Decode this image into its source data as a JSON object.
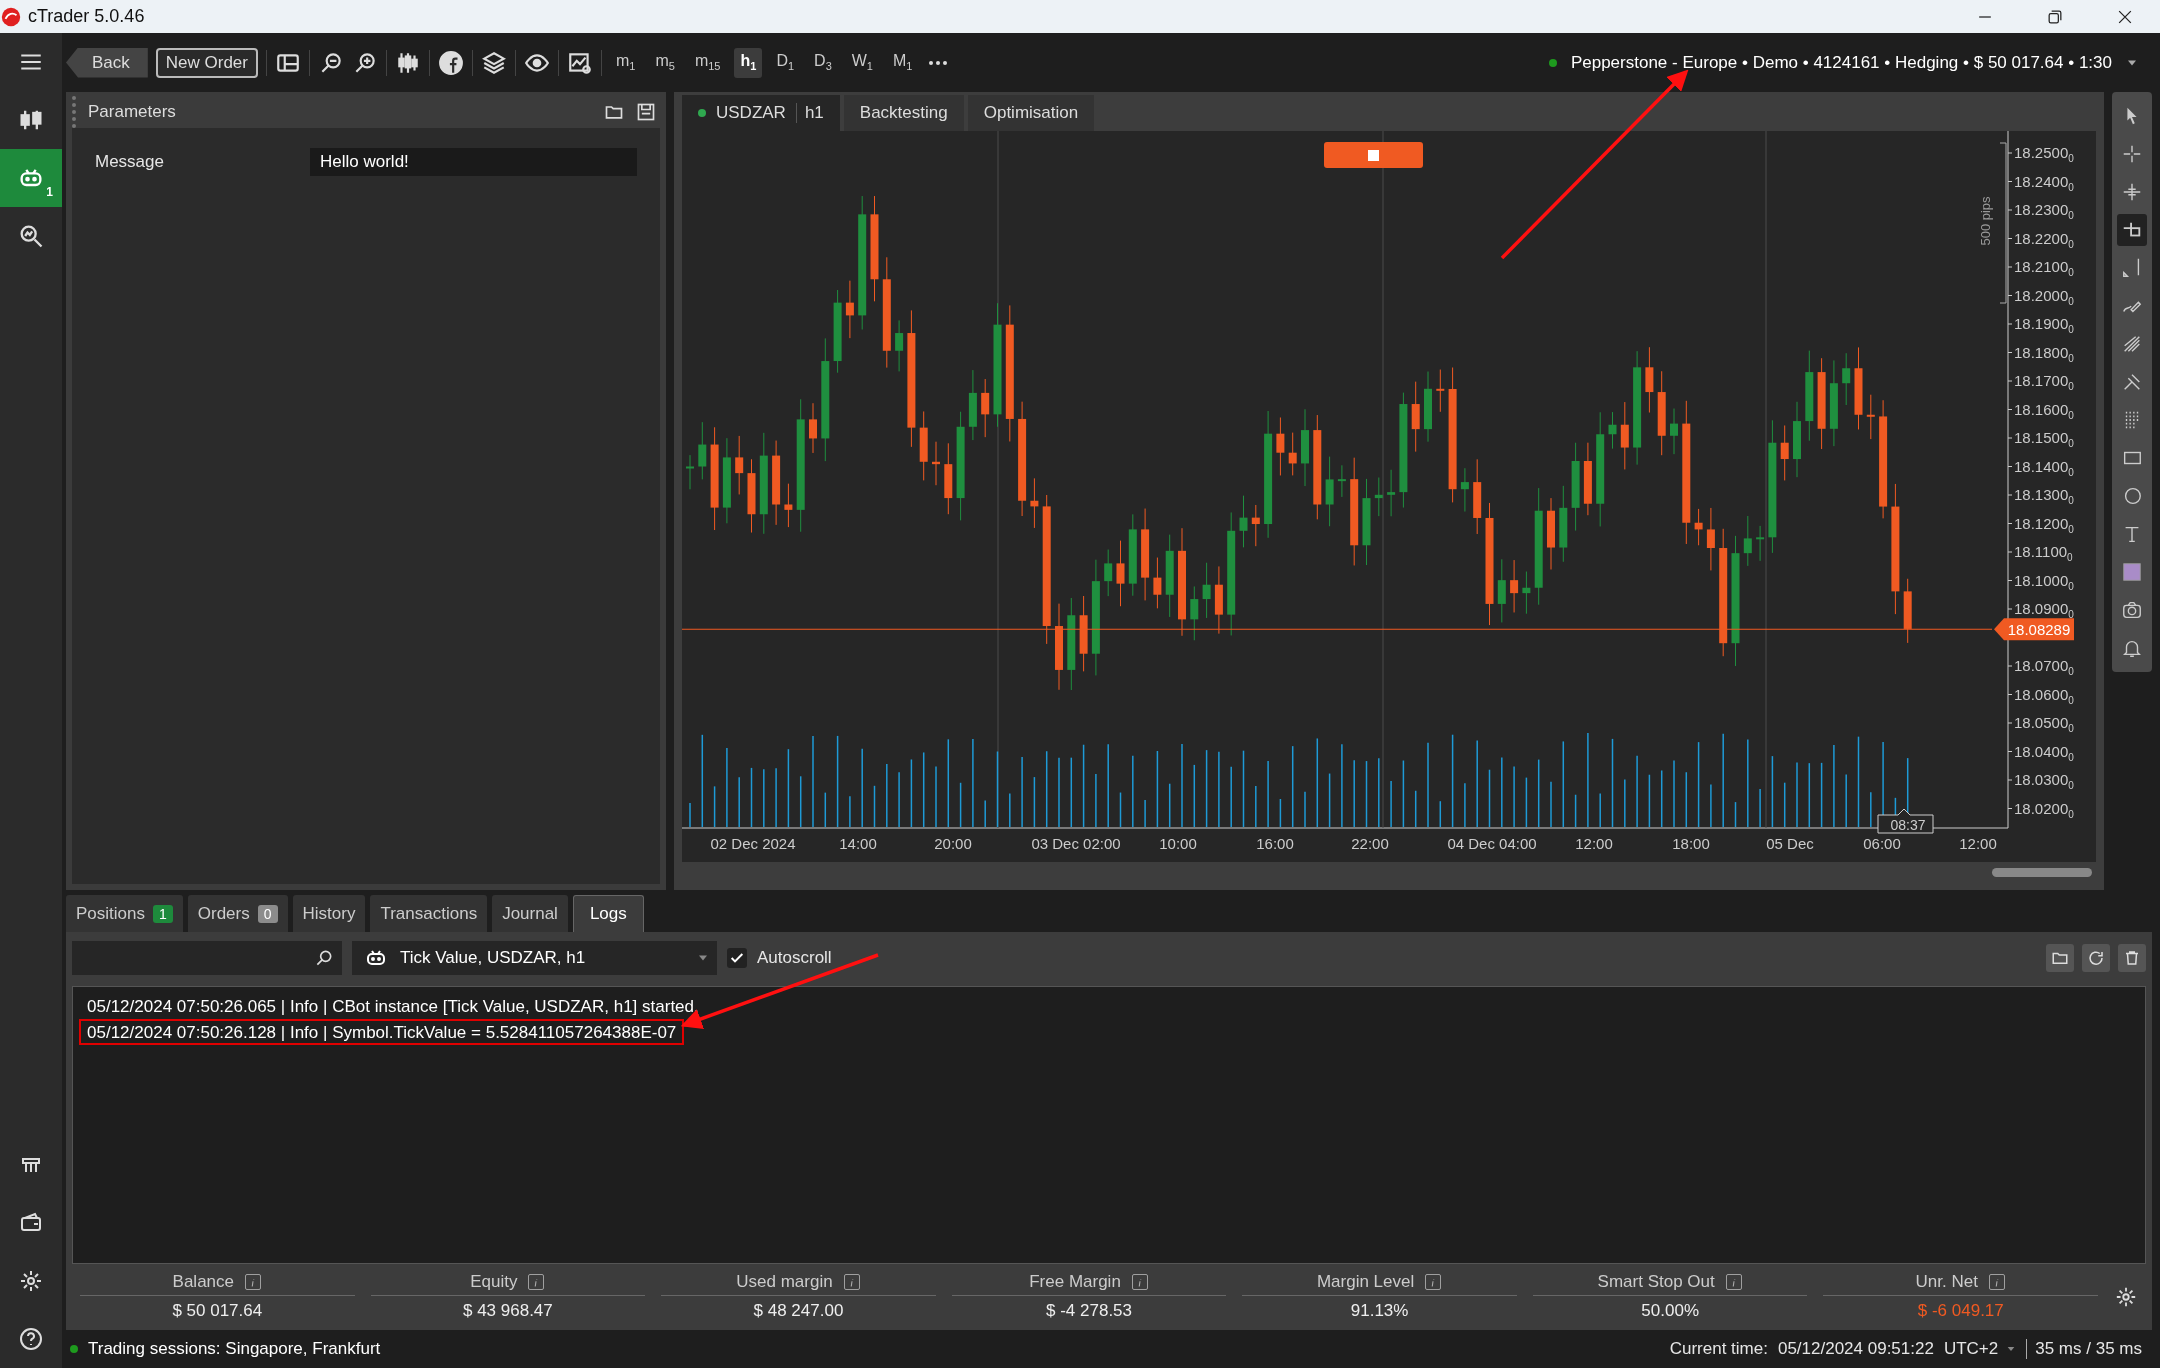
{
  "window": {
    "title": "cTrader 5.0.46"
  },
  "sidebar": {
    "items": [
      {
        "kind": "candles",
        "selected": false
      },
      {
        "kind": "bot",
        "selected": true,
        "badge": "1"
      },
      {
        "kind": "analyze",
        "selected": false
      }
    ],
    "bottom_items": [
      {
        "kind": "bank"
      },
      {
        "kind": "wallet"
      },
      {
        "kind": "settings"
      },
      {
        "kind": "help"
      }
    ]
  },
  "toolbar": {
    "buttons": [
      {
        "kind": "back",
        "label": "Back"
      },
      {
        "kind": "outline",
        "label": "New Order"
      }
    ],
    "timeframes": [
      {
        "label": "m$_{1}$",
        "selected": false
      },
      {
        "label": "m$_{5}$",
        "selected": false
      },
      {
        "label": "m$_{15}$",
        "selected": false
      },
      {
        "label": "h$_{1}$",
        "selected": true
      },
      {
        "label": "D$_{1}$",
        "selected": false
      },
      {
        "label": "D$_{3}$",
        "selected": false
      },
      {
        "label": "W$_{1}$",
        "selected": false
      },
      {
        "label": "M$_{1}$",
        "selected": false
      }
    ],
    "account": {
      "connected": true,
      "text": "Pepperstone - Europe • Demo • 4124161 • Hedging • $ 50 017.64 • 1:30"
    }
  },
  "parameters": {
    "title": "Parameters",
    "fields": [
      {
        "label": "Message",
        "value": "Hello world!"
      }
    ]
  },
  "chart_tabs": [
    {
      "label": "USDZAR",
      "timeframe": "h1",
      "selected": true
    },
    {
      "label": "Backtesting",
      "selected": false
    },
    {
      "label": "Optimisation",
      "selected": false
    }
  ],
  "chart": {
    "price_labels": [
      "18.2500$_{0}$",
      "18.2400$_{0}$",
      "18.2300$_{0}$",
      "18.2200$_{0}$",
      "18.2100$_{0}$",
      "18.2000$_{0}$",
      "18.1900$_{0}$",
      "18.1800$_{0}$",
      "18.1700$_{0}$",
      "18.1600$_{0}$",
      "18.1500$_{0}$",
      "18.1400$_{0}$",
      "18.1300$_{0}$",
      "18.1200$_{0}$",
      "18.1100$_{0}$",
      "18.1000$_{0}$",
      "18.0900$_{0}$",
      "18.0700$_{0}$",
      "18.0600$_{0}$",
      "18.0500$_{0}$",
      "18.0400$_{0}$",
      "18.0300$_{0}$",
      "18.0200$_{0}$"
    ],
    "current_price": "18.08289",
    "range_label": "500 pips",
    "cursor_time": "08:37",
    "time_labels": [
      "02 Dec 2024",
      "14:00",
      "20:00",
      "03 Dec 02:00",
      "10:00",
      "16:00",
      "22:00",
      "04 Dec 04:00",
      "12:00",
      "18:00",
      "05 Dec",
      "06:00",
      "12:00"
    ]
  },
  "drawing_tools": [
    {
      "kind": "pointer",
      "selected": false
    },
    {
      "kind": "crosshair",
      "selected": false
    },
    {
      "kind": "crosshair-dashed",
      "selected": false
    },
    {
      "kind": "crop",
      "selected": true
    },
    {
      "kind": "vline",
      "selected": false
    },
    {
      "kind": "pencil",
      "selected": false
    },
    {
      "kind": "fan",
      "selected": false
    },
    {
      "kind": "pitchfork",
      "selected": false
    },
    {
      "kind": "grid",
      "selected": false
    },
    {
      "kind": "rect",
      "selected": false
    },
    {
      "kind": "circle",
      "selected": false
    },
    {
      "kind": "text",
      "selected": false
    },
    {
      "kind": "swatch",
      "selected": false
    },
    {
      "kind": "camera",
      "selected": false
    },
    {
      "kind": "bell",
      "selected": false
    }
  ],
  "bottom_tabs": [
    {
      "label": "Positions",
      "count": "1",
      "color": "#1e8a3c",
      "selected": false
    },
    {
      "label": "Orders",
      "count": "0",
      "color": "#8c8c8c",
      "selected": false
    },
    {
      "label": "History",
      "selected": false
    },
    {
      "label": "Transactions",
      "selected": false
    },
    {
      "label": "Journal",
      "selected": false
    },
    {
      "label": "Logs",
      "selected": true
    }
  ],
  "logs": {
    "instance": "Tick Value, USDZAR, h1",
    "autoscroll": {
      "label": "Autoscroll",
      "checked": true
    },
    "lines": [
      {
        "text": "05/12/2024 07:50:26.065 | Info | CBot instance [Tick Value, USDZAR, h1] started.",
        "highlighted": false
      },
      {
        "text": "05/12/2024 07:50:26.128 | Info | Symbol.TickValue = 5.528411057264388E-07",
        "highlighted": true
      }
    ]
  },
  "stats": [
    {
      "label": "Balance",
      "value": "$ 50 017.64",
      "negative": false
    },
    {
      "label": "Equity",
      "value": "$ 43 968.47",
      "negative": false
    },
    {
      "label": "Used margin",
      "value": "$ 48 247.00",
      "negative": false
    },
    {
      "label": "Free Margin",
      "value": "$ -4 278.53",
      "negative": false
    },
    {
      "label": "Margin Level",
      "value": "91.13%",
      "negative": false
    },
    {
      "label": "Smart Stop Out",
      "value": "50.00%",
      "negative": false
    },
    {
      "label": "Unr. Net",
      "value": "$ -6 049.17",
      "negative": true
    }
  ],
  "status_bar": {
    "sessions": "Trading sessions: Singapore, Frankfurt",
    "time_label": "Current time:",
    "time": "05/12/2024 09:51:22",
    "timezone": "UTC+2",
    "latency": "35 ms / 35 ms"
  }
}
